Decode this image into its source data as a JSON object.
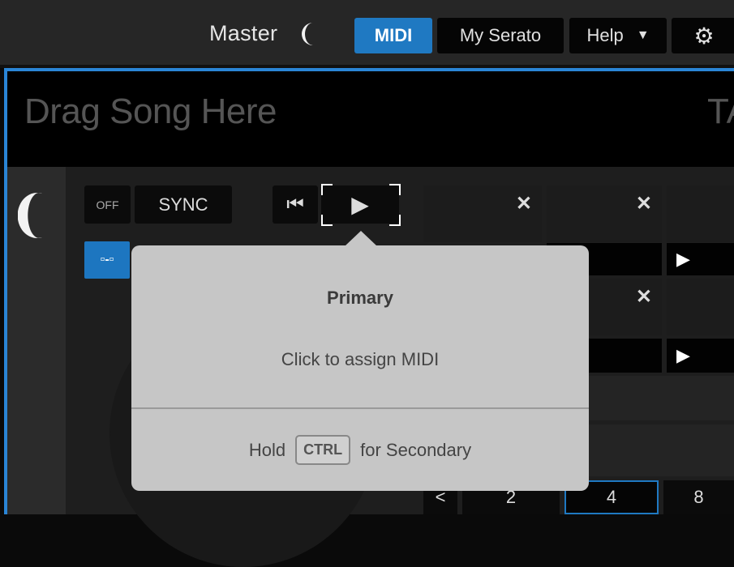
{
  "topbar": {
    "master_label": "Master",
    "buttons": {
      "midi": "MIDI",
      "my_serato": "My Serato",
      "help": "Help",
      "help_caret": "▼",
      "settings_icon": "⚙"
    }
  },
  "deck": {
    "drag_song": "Drag Song Here",
    "right_label": "TA",
    "off": "OFF",
    "sync": "SYNC",
    "prev_icon": "⏮",
    "play_icon": "▶",
    "link_icon": "▫‑▫"
  },
  "cues": {
    "remove_icon": "✕",
    "play_icon": "▶"
  },
  "pager": {
    "back": "<",
    "pages": [
      "2",
      "4",
      "8"
    ],
    "selected": "4"
  },
  "popup": {
    "title": "Primary",
    "assign": "Click to assign MIDI",
    "hold": "Hold",
    "key": "CTRL",
    "secondary": "for Secondary"
  },
  "colors": {
    "accent": "#1f79c2",
    "popup_bg": "#c6c6c6"
  }
}
